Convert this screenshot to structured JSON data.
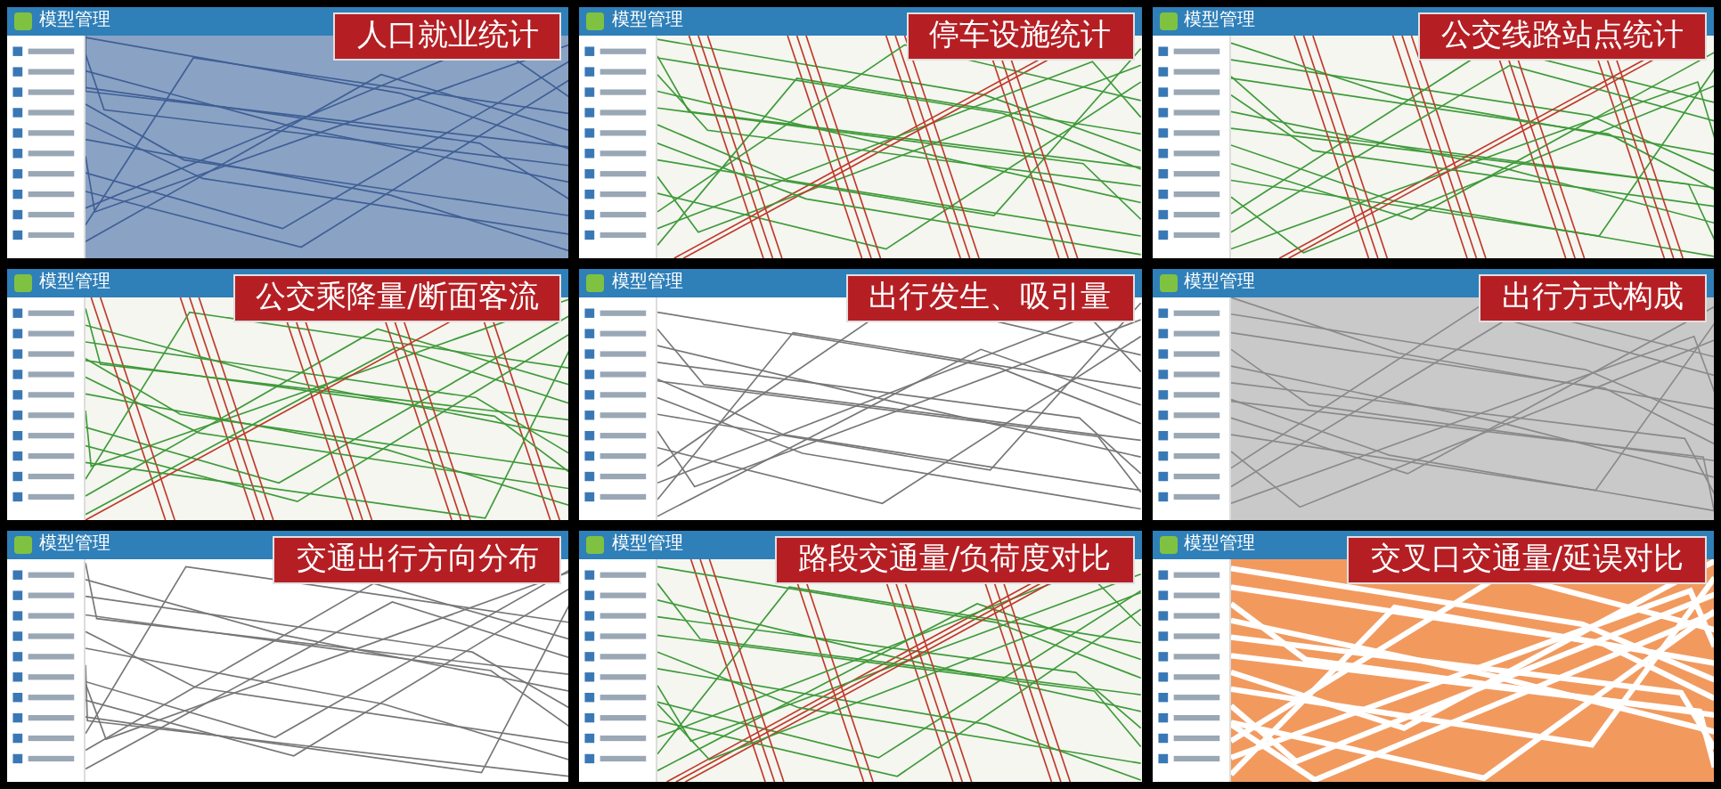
{
  "panels": [
    {
      "app_title": "模型管理",
      "banner": "人口就业统计",
      "kind": "choropleth"
    },
    {
      "app_title": "模型管理",
      "banner": "停车设施统计",
      "kind": "network"
    },
    {
      "app_title": "模型管理",
      "banner": "公交线路站点统计",
      "kind": "network"
    },
    {
      "app_title": "模型管理",
      "banner": "公交乘降量/断面客流",
      "kind": "network"
    },
    {
      "app_title": "模型管理",
      "banner": "出行发生、吸引量",
      "kind": "lines"
    },
    {
      "app_title": "模型管理",
      "banner": "出行方式构成",
      "kind": "gray"
    },
    {
      "app_title": "模型管理",
      "banner": "交通出行方向分布",
      "kind": "lines"
    },
    {
      "app_title": "模型管理",
      "banner": "路段交通量/负荷度对比",
      "kind": "network"
    },
    {
      "app_title": "模型管理",
      "banner": "交叉口交通量/延误对比",
      "kind": "orange"
    }
  ]
}
